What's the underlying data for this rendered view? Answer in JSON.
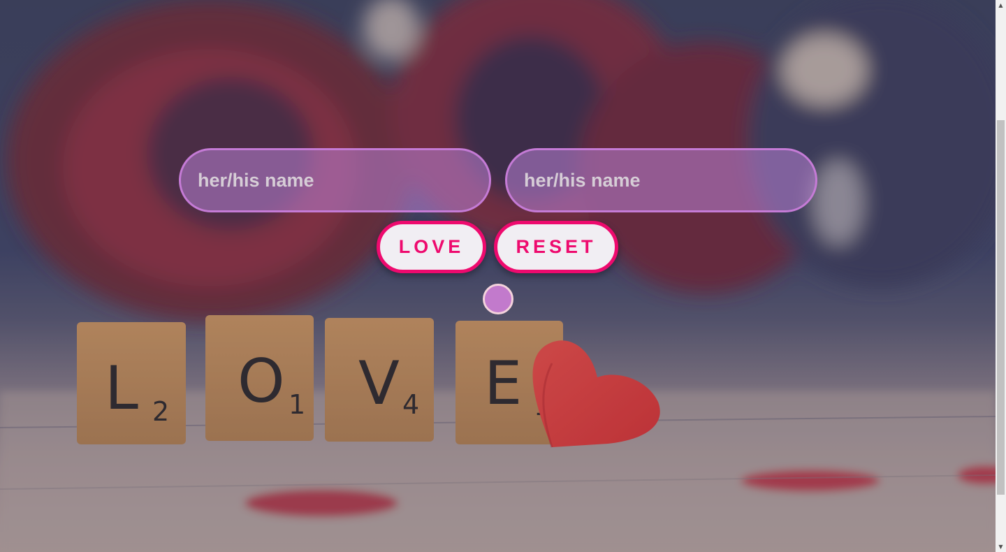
{
  "form": {
    "first_name": {
      "value": "",
      "placeholder": "her/his name"
    },
    "second_name": {
      "value": "",
      "placeholder": "her/his name"
    }
  },
  "buttons": {
    "love_label": "LOVE",
    "reset_label": "RESET"
  },
  "background": {
    "tiles": [
      {
        "letter": "L",
        "score": "2"
      },
      {
        "letter": "O",
        "score": "1"
      },
      {
        "letter": "V",
        "score": "4"
      },
      {
        "letter": "E",
        "score": "1"
      }
    ]
  },
  "colors": {
    "accent": "#ee0a6e",
    "input_border": "#c57bd6",
    "dot": "#c27acc"
  }
}
